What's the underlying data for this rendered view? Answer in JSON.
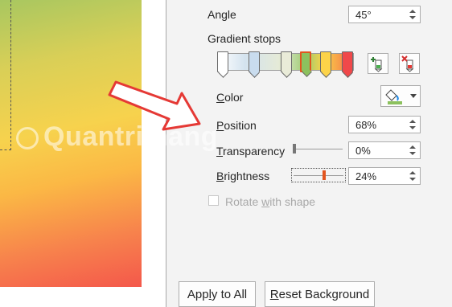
{
  "angle": {
    "label": "Angle",
    "value": "45°"
  },
  "gradient_stops": {
    "label": "Gradient stops",
    "stops": [
      {
        "color": "#ffffff",
        "selected": false
      },
      {
        "color": "#c9dcee",
        "selected": false
      },
      {
        "color": "#e9ebd8",
        "selected": false
      },
      {
        "color": "#8cc15e",
        "selected": true
      },
      {
        "color": "#fcd349",
        "selected": false
      },
      {
        "color": "#f0484a",
        "selected": false
      }
    ],
    "add_stop_icon": "add-gradient-stop-icon",
    "remove_stop_icon": "remove-gradient-stop-icon"
  },
  "color": {
    "label": "Color",
    "swatch": "#8cc15e"
  },
  "position": {
    "label": "Position",
    "value": "68%"
  },
  "transparency": {
    "label": "Transparency",
    "value": "0%",
    "level": 0
  },
  "brightness": {
    "label": "Brightness",
    "value": "24%",
    "level": 0.24
  },
  "rotate": {
    "label": "Rotate with shape",
    "checked": false
  },
  "buttons": {
    "apply_all": "Apply to All",
    "reset_background": "Reset Background"
  },
  "watermark": "Quantrimang",
  "colors": {
    "pane_bg": "#f3f3f3",
    "selected_stop_border": "#e2541e",
    "arrow_red": "#e53935"
  }
}
